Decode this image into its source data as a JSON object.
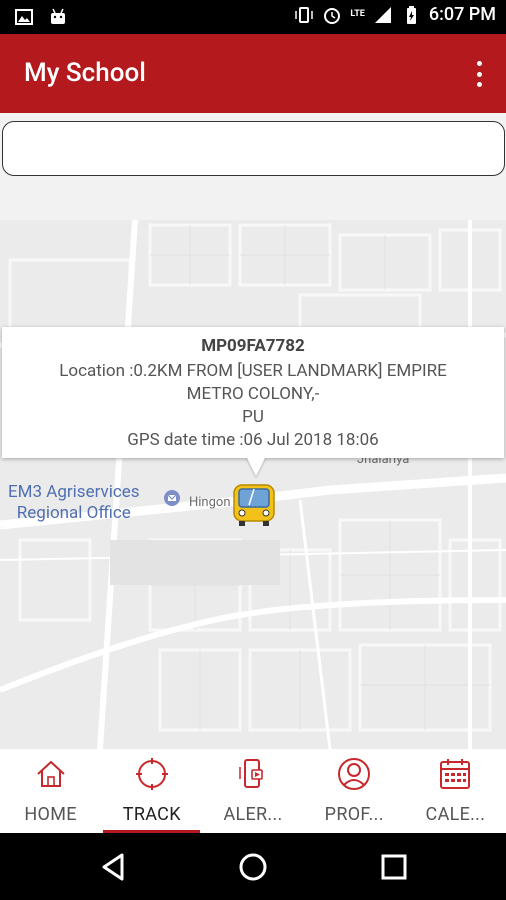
{
  "status_bar": {
    "time": "6:07 PM",
    "network_label": "LTE",
    "icons": [
      "image-icon",
      "android-icon",
      "vibrate-icon",
      "alarm-icon",
      "signal-icon",
      "battery-icon"
    ]
  },
  "app_bar": {
    "title": "My School",
    "menu_icon": "overflow-menu-icon"
  },
  "search": {
    "placeholder": ""
  },
  "map": {
    "labels": {
      "office_line1": "EM3 Agriservices",
      "office_line2": "Regional Office",
      "road": "Hingon",
      "area": "Jhalariya"
    },
    "marker_icon": "bus-icon"
  },
  "info_window": {
    "vehicle": "MP09FA7782",
    "location_line1": "Location   :0.2KM FROM [USER LANDMARK] EMPIRE",
    "location_line2": "METRO COLONY,-",
    "location_line3": "PU",
    "gps_line": "GPS date time :06 Jul 2018 18:06"
  },
  "bottom_nav": {
    "items": [
      {
        "label": "HOME",
        "icon": "home-icon",
        "active": false
      },
      {
        "label": "TRACK",
        "icon": "track-icon",
        "active": true
      },
      {
        "label": "ALER...",
        "icon": "alert-icon",
        "active": false
      },
      {
        "label": "PROF...",
        "icon": "profile-icon",
        "active": false
      },
      {
        "label": "CALE...",
        "icon": "calendar-icon",
        "active": false
      }
    ]
  },
  "system_nav": {
    "icons": [
      "back-icon",
      "home-circle-icon",
      "recents-icon"
    ]
  },
  "colors": {
    "primary": "#b3191d",
    "map_bg": "#ebebeb",
    "map_label": "#4f6fb2"
  }
}
